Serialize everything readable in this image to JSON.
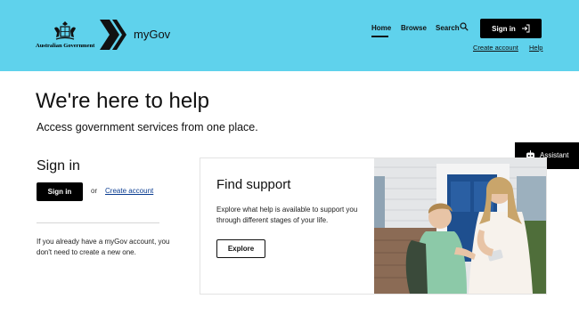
{
  "header": {
    "gov_logo_text": "Australian Government",
    "brand": "myGov",
    "nav": {
      "home": "Home",
      "browse": "Browse",
      "search": "Search"
    },
    "sign_in": "Sign in",
    "create_account": "Create account",
    "help": "Help",
    "bg_color": "#5fd2ec"
  },
  "hero": {
    "title": "We're here to help",
    "subtitle": "Access government services from one place."
  },
  "assistant": {
    "label": "Assistant"
  },
  "signin_section": {
    "title": "Sign in",
    "button": "Sign in",
    "or": "or",
    "create_account": "Create account",
    "info": "If you already have a myGov account, you don't need to create a new one."
  },
  "support_card": {
    "title": "Find support",
    "description": "Explore what help is available to support you through different stages of your life.",
    "button": "Explore"
  },
  "icons": {
    "search": "search-icon",
    "sign_in_arrow": "sign-in-arrow-icon",
    "assistant": "chatbot-icon",
    "brand": "mygov-chevron-logo"
  }
}
